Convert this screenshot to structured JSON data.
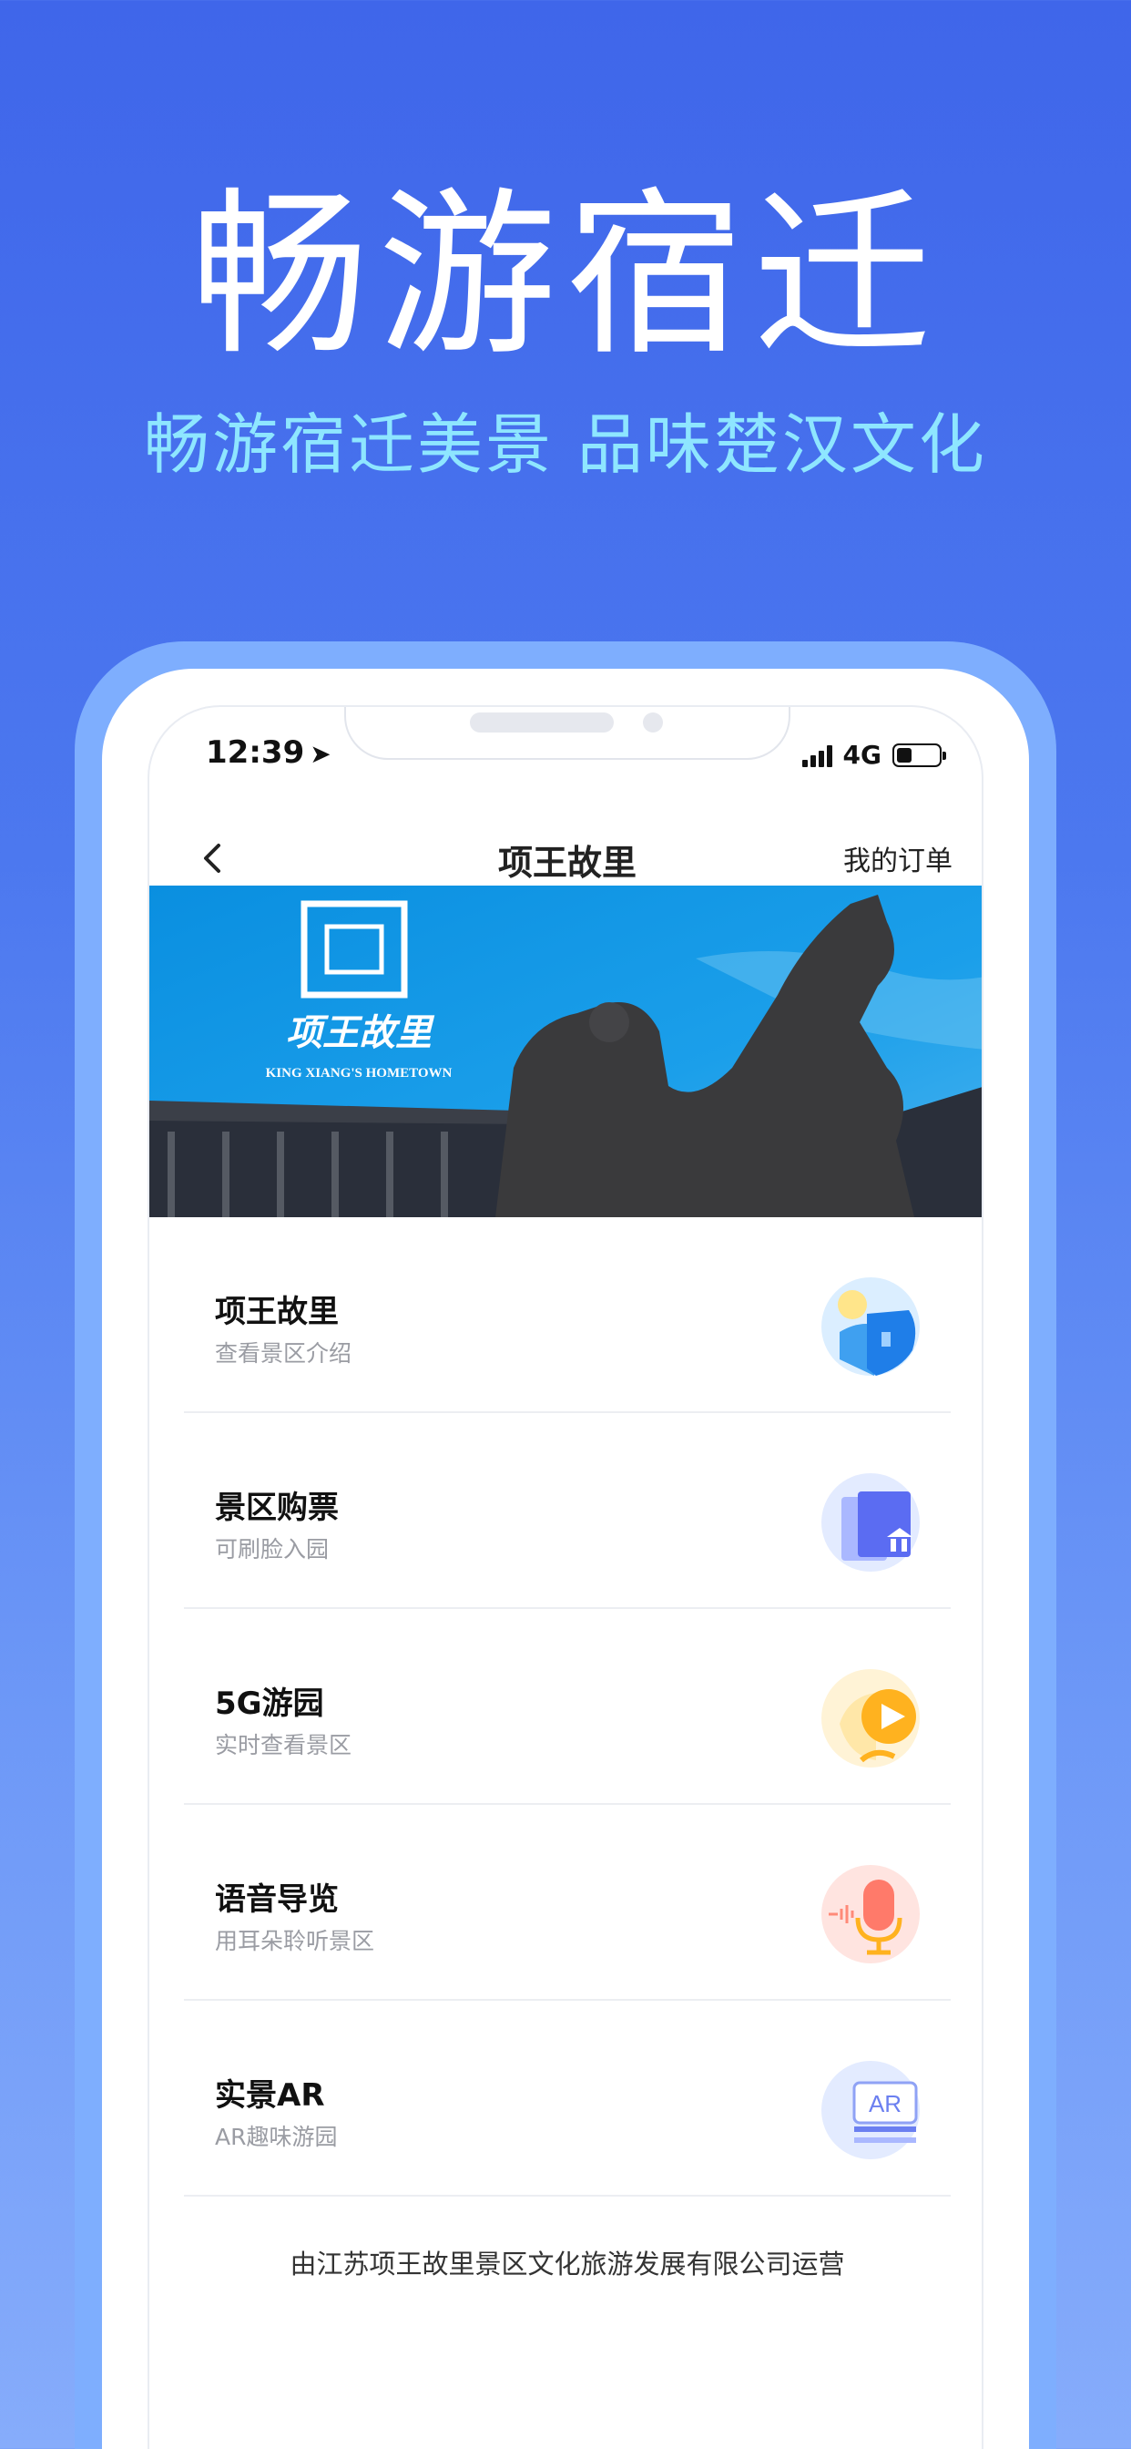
{
  "promo": {
    "headline": "畅游宿迁",
    "tagline": "畅游宿迁美景 品味楚汉文化"
  },
  "status_bar": {
    "time": "12:39",
    "network": "4G"
  },
  "nav": {
    "title": "项王故里",
    "orders": "我的订单"
  },
  "banner": {
    "logo_text": "项王故里",
    "logo_subtext": "KING XIANG'S HOMETOWN"
  },
  "menu": [
    {
      "title": "项王故里",
      "subtitle": "查看景区介绍",
      "icon": "scenic-icon"
    },
    {
      "title": "景区购票",
      "subtitle": "可刷脸入园",
      "icon": "ticket-icon"
    },
    {
      "title": "5G游园",
      "subtitle": "实时查看景区",
      "icon": "video-play-icon"
    },
    {
      "title": "语音导览",
      "subtitle": "用耳朵聆听景区",
      "icon": "microphone-icon"
    },
    {
      "title": "实景AR",
      "subtitle": "AR趣味游园",
      "icon": "ar-icon"
    }
  ],
  "footer": "由江苏项王故里景区文化旅游发展有限公司运营",
  "colors": {
    "background_top": "#3f66ea",
    "background_bottom": "#86acfb",
    "tagline": "#8ee6ff",
    "phone_bezel": "#7eaefe"
  }
}
